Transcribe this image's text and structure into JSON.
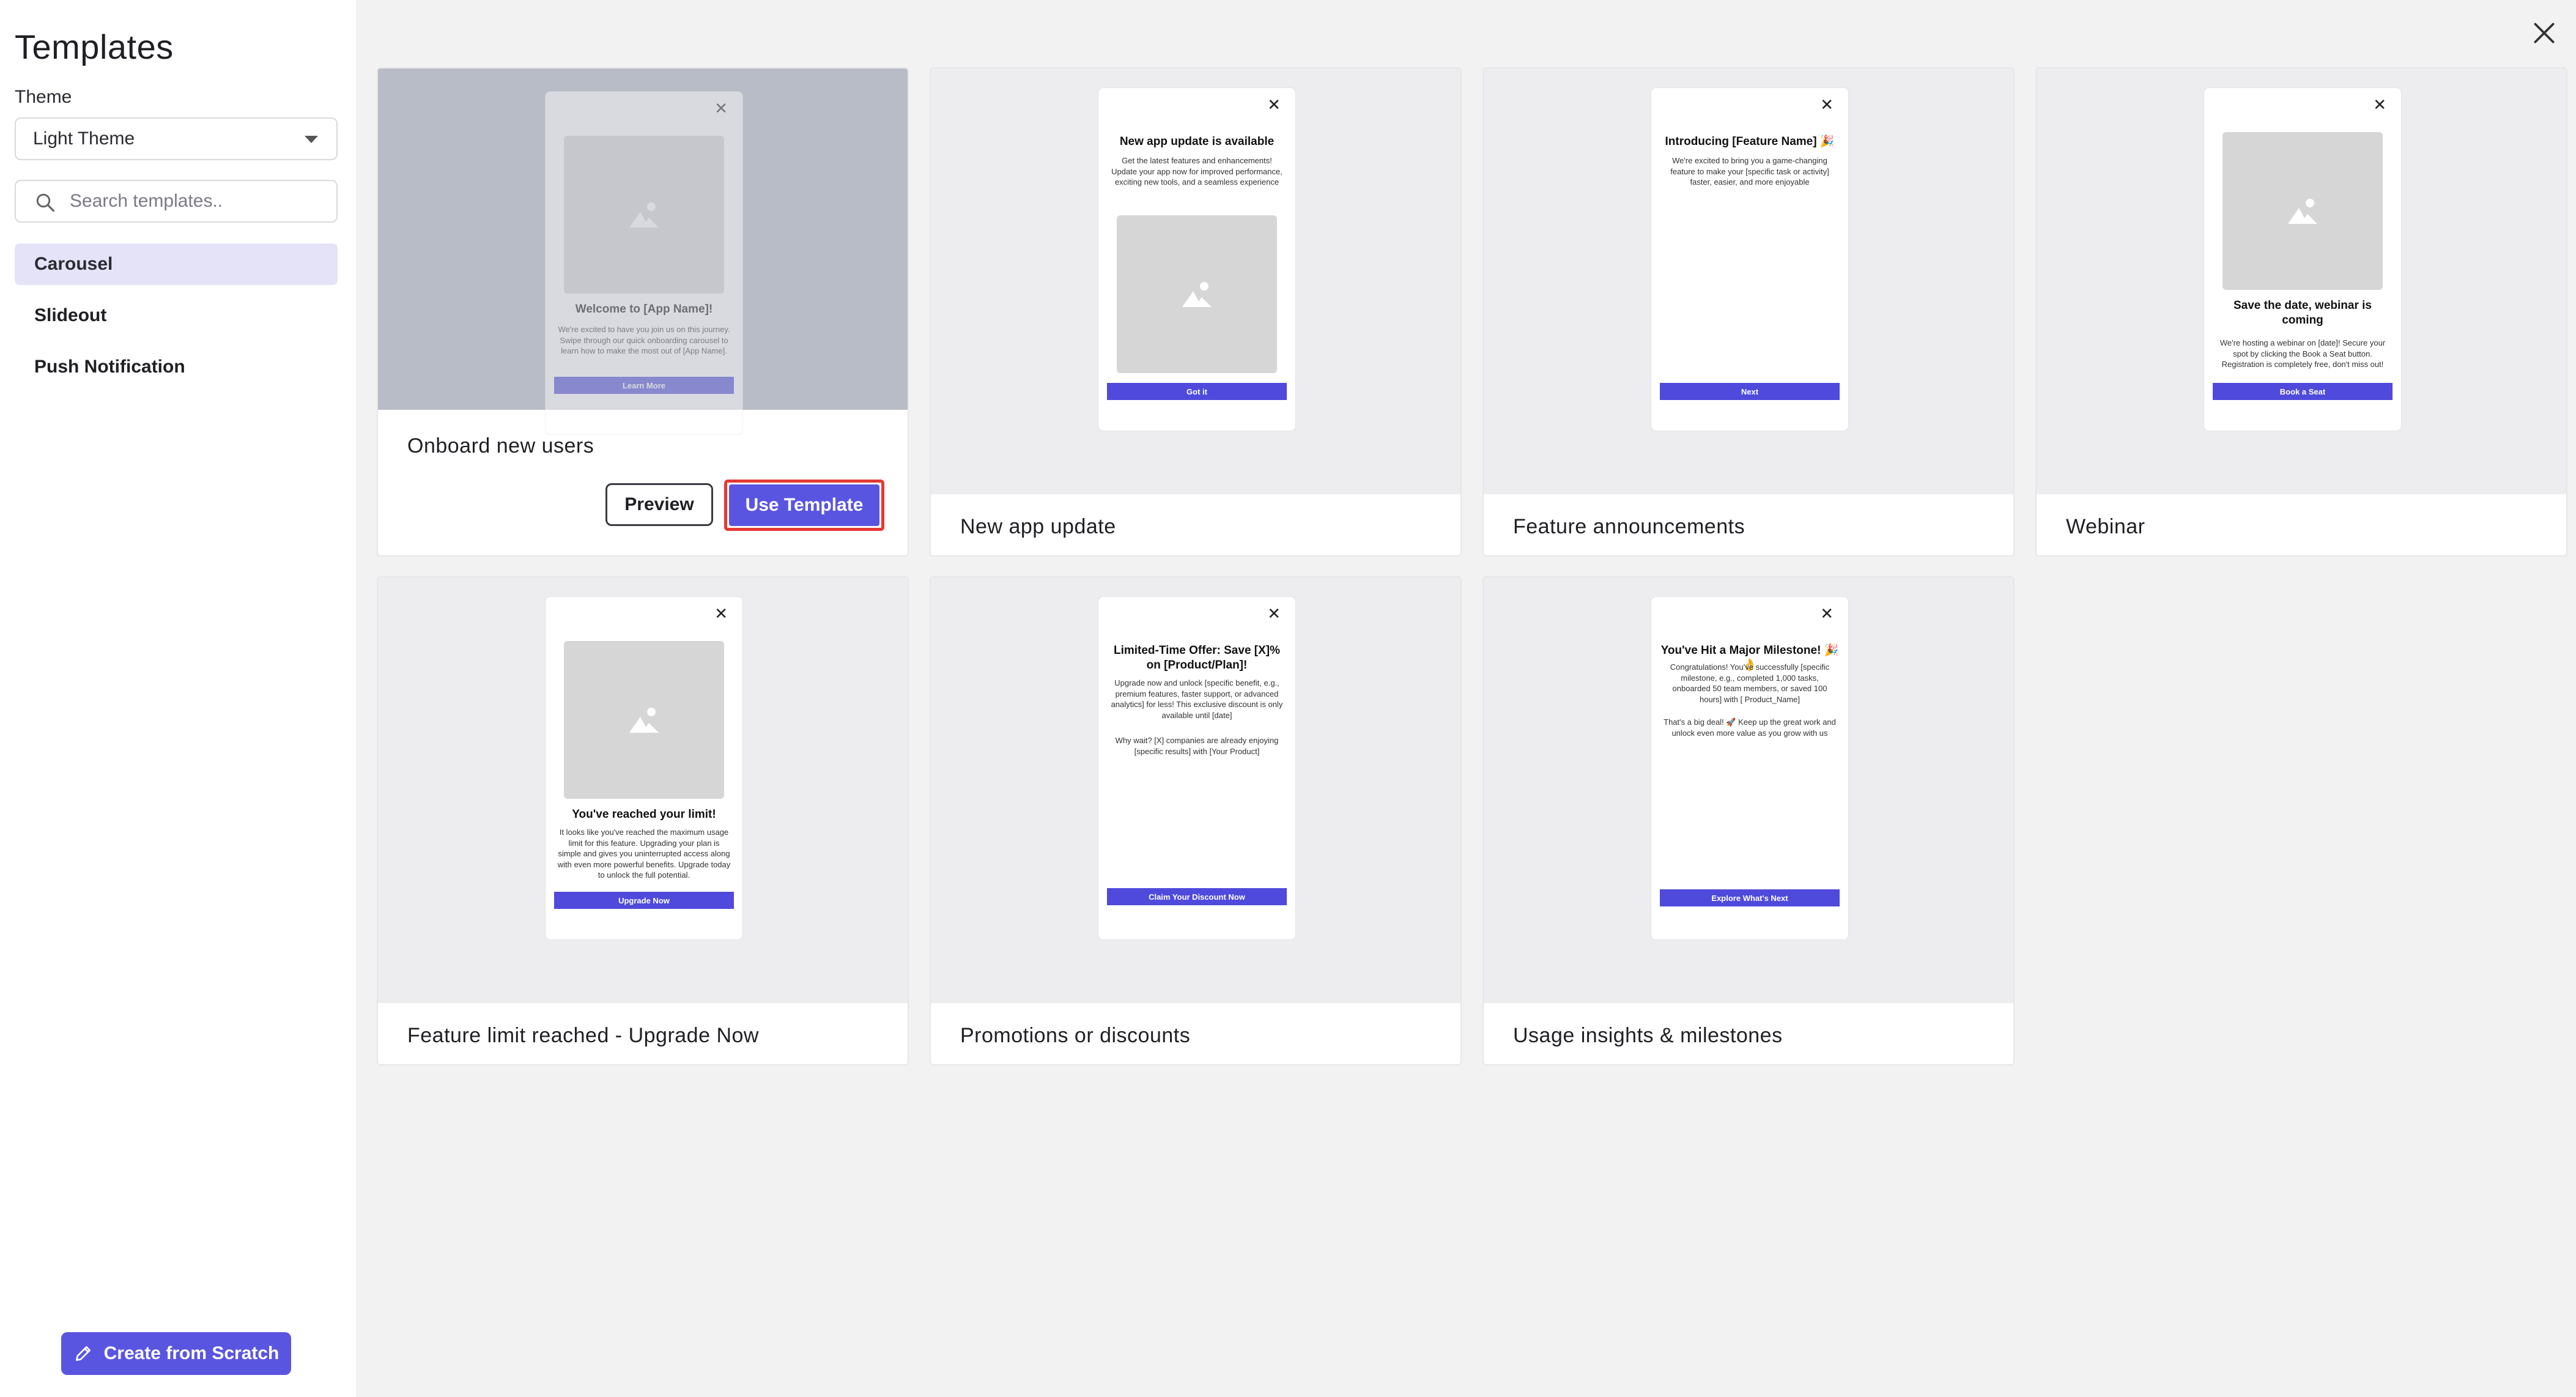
{
  "sidebar": {
    "title": "Templates",
    "theme_label": "Theme",
    "theme_value": "Light Theme",
    "search_placeholder": "Search templates..",
    "nav": [
      "Carousel",
      "Slideout",
      "Push Notification"
    ],
    "create_label": "Create from Scratch"
  },
  "cards": [
    {
      "title": "Onboard new users",
      "preview_label": "Preview",
      "use_label": "Use Template",
      "mock": {
        "heading": "Welcome to [App Name]!",
        "body": "We're excited to have you join us on this journey. Swipe through our quick onboarding carousel to learn how to make the most out of [App Name].",
        "button": "Learn More"
      }
    },
    {
      "title": "New app update",
      "mock": {
        "heading": "New app update is available",
        "body": "Get the latest features and enhancements! Update your app now for improved performance, exciting new tools, and a seamless experience",
        "button": "Got it"
      }
    },
    {
      "title": "Feature announcements",
      "mock": {
        "heading": "Introducing [Feature Name] 🎉",
        "body": "We're excited to bring you a game-changing feature to make your [specific task or activity] faster, easier, and more enjoyable",
        "button": "Next"
      }
    },
    {
      "title": "Webinar",
      "mock": {
        "heading": "Save the date, webinar is coming",
        "body": "We're hosting a webinar on [date]! Secure your spot by clicking the Book a Seat button. Registration is completely free, don't miss out!",
        "button": "Book a Seat"
      }
    },
    {
      "title": "Feature limit reached - Upgrade Now",
      "mock": {
        "heading": "You've reached your limit!",
        "body": "It looks like you've reached the maximum usage limit for this feature. Upgrading your plan is simple and gives you uninterrupted access along with even more powerful benefits. Upgrade today to unlock the full potential.",
        "button": "Upgrade Now"
      }
    },
    {
      "title": "Promotions or discounts",
      "mock": {
        "heading": "Limited-Time Offer: Save [X]% on [Product/Plan]!",
        "body": "Upgrade now and unlock [specific benefit, e.g., premium features, faster support, or advanced analytics] for less! This exclusive discount is only available until [date]",
        "body2": "Why wait? [X] companies are already enjoying [specific results] with [Your Product]",
        "button": "Claim Your Discount Now"
      }
    },
    {
      "title": "Usage insights & milestones",
      "mock": {
        "heading": "You've Hit a Major Milestone! 🎉👌",
        "body": "Congratulations! You've successfully [specific milestone, e.g., completed 1,000 tasks, onboarded 50 team members, or saved 100 hours] with [ Product_Name]",
        "body2": "That's a big deal! 🚀 Keep up the great work and unlock even more value as you grow with us",
        "button": "Explore What's Next"
      }
    }
  ],
  "colors": {
    "accent": "#5a55e0",
    "highlight_border": "#e53935",
    "nav_active_bg": "#e4e3f8"
  }
}
